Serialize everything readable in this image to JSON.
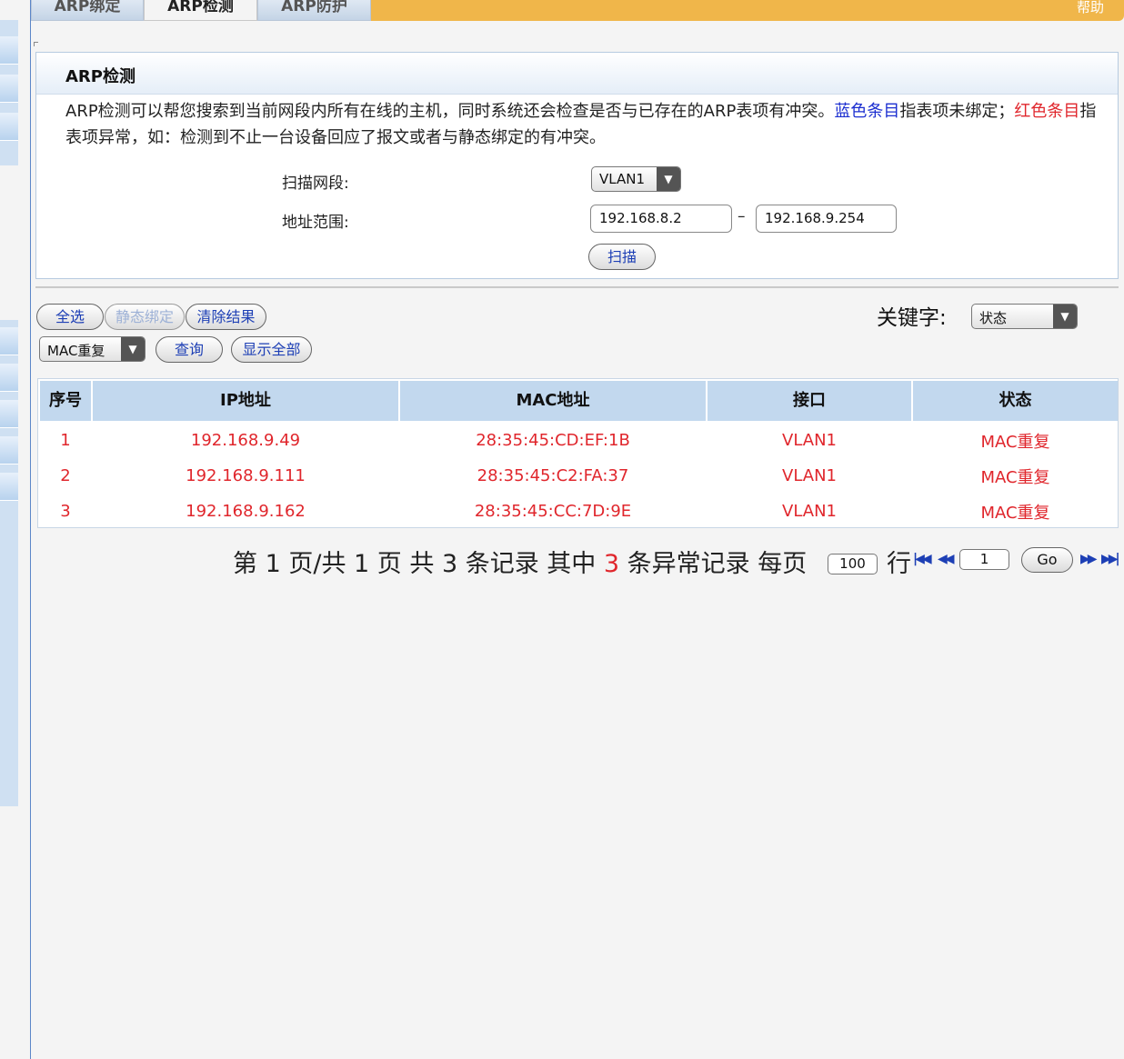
{
  "tabs": [
    {
      "label": "ARP绑定",
      "active": false
    },
    {
      "label": "ARP检测",
      "active": true
    },
    {
      "label": "ARP防护",
      "active": false
    }
  ],
  "help_label": "帮助",
  "panel": {
    "title": "ARP检测",
    "desc_part1": "ARP检测可以帮您搜索到当前网段内所有在线的主机，同时系统还会检查是否与已存在的ARP表项有冲突。",
    "desc_blue": "蓝色条目",
    "desc_part2": "指表项未绑定；",
    "desc_red": "红色条目",
    "desc_part3": "指表项异常，如：检测到不止一台设备回应了报文或者与静态绑定的有冲突。",
    "scan_segment_label": "扫描网段:",
    "scan_segment_value": "VLAN1",
    "address_range_label": "地址范围:",
    "range_start": "192.168.8.2",
    "range_end": "192.168.9.254",
    "scan_button": "扫描"
  },
  "toolbar": {
    "select_all": "全选",
    "static_bind": "静态绑定",
    "clear_results": "清除结果",
    "keyword_label": "关键字:",
    "keyword_select": "状态",
    "filter_select": "MAC重复",
    "query": "查询",
    "show_all": "显示全部"
  },
  "table": {
    "headers": [
      "序号",
      "IP地址",
      "MAC地址",
      "接口",
      "状态"
    ],
    "rows": [
      [
        "1",
        "192.168.9.49",
        "28:35:45:CD:EF:1B",
        "VLAN1",
        "MAC重复"
      ],
      [
        "2",
        "192.168.9.111",
        "28:35:45:C2:FA:37",
        "VLAN1",
        "MAC重复"
      ],
      [
        "3",
        "192.168.9.162",
        "28:35:45:CC:7D:9E",
        "VLAN1",
        "MAC重复"
      ]
    ]
  },
  "pager": {
    "text_before": "第 1 页/共 1 页 共 3 条记录 其中 ",
    "abnormal_count": "3",
    "text_after": " 条异常记录 每页",
    "per_page": "100",
    "row_word": "行",
    "page_input": "1",
    "go": "Go"
  },
  "colors": {
    "tab_bar": "#f0b64a",
    "header_bg": "#c2d8ee",
    "abnormal_red": "#e0262c",
    "link_blue": "#1d3fb5"
  }
}
